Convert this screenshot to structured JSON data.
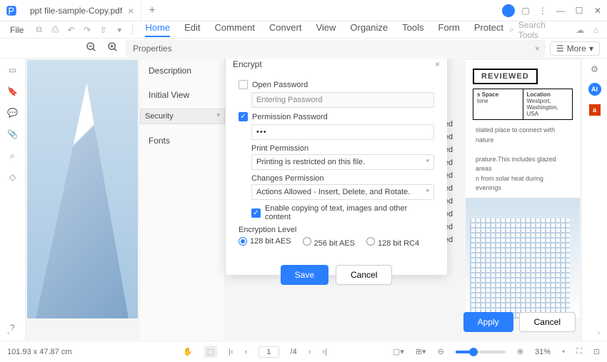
{
  "titlebar": {
    "tab": "ppt file-sample-Copy.pdf"
  },
  "menu": {
    "file": "File",
    "tabs": [
      "Home",
      "Edit",
      "Comment",
      "Convert",
      "View",
      "Organize",
      "Tools",
      "Form",
      "Protect"
    ],
    "search": "Search Tools"
  },
  "toolbar": {
    "more": "More",
    "props_header": "Properties"
  },
  "props": {
    "items": [
      "Description",
      "Initial View",
      "Security",
      "Fonts"
    ]
  },
  "allowed": [
    "ot Allowed",
    "ot Allowed",
    "Allowed",
    "ot Allowed",
    "ot Allowed",
    "ot Allowed",
    "ot Allowed",
    "ot Allowed",
    "ot Allowed",
    "ot Allowed"
  ],
  "panel": {
    "apply": "Apply",
    "cancel": "Cancel"
  },
  "encrypt": {
    "title": "Encrypt",
    "open_pw": "Open Password",
    "open_pw_ph": "Entering Password",
    "perm_pw": "Permission Password",
    "perm_pw_val": "•••",
    "print_lbl": "Print Permission",
    "print_val": "Printing is restricted on this file.",
    "change_lbl": "Changes Permission",
    "change_val": "Actions Allowed - Insert, Delete, and Rotate.",
    "copy_lbl": "Enable copying of text, images and other content",
    "enc_lvl": "Encryption Level",
    "opt1": "128 bit AES",
    "opt2": "256 bit AES",
    "opt3": "128 bit RC4",
    "save": "Save",
    "cancel": "Cancel"
  },
  "doc": {
    "reviewed": "REVIEWED",
    "col1h": "s Space",
    "col1v": "tone",
    "col2h": "Location",
    "col2v": "Westport,\nWashington, USA",
    "line1": "olated place to connect with nature",
    "line2": "prature.This includes glazed areas",
    "line3": "n from solar heat during evenings"
  },
  "status": {
    "coords": "101.93 x 47.87 cm",
    "page_cur": "1",
    "page_tot": "/4",
    "zoom": "31%"
  }
}
